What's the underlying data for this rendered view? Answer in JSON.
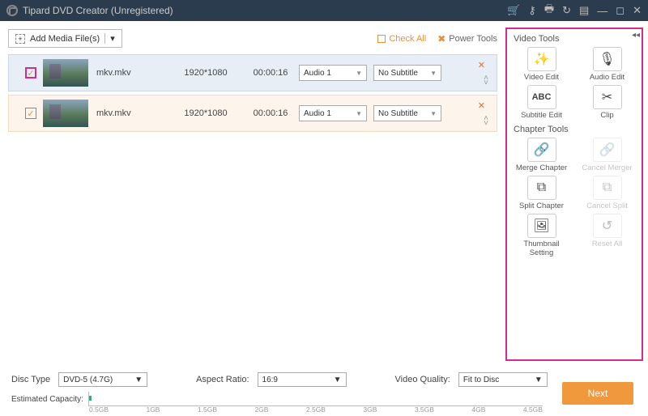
{
  "titlebar": {
    "title": "Tipard DVD Creator (Unregistered)"
  },
  "toolbar": {
    "add_label": "Add Media File(s)",
    "check_all": "Check All",
    "power_tools": "Power Tools"
  },
  "rows": [
    {
      "filename": "mkv.mkv",
      "resolution": "1920*1080",
      "duration": "00:00:16",
      "audio": "Audio 1",
      "subtitle": "No Subtitle"
    },
    {
      "filename": "mkv.mkv",
      "resolution": "1920*1080",
      "duration": "00:00:16",
      "audio": "Audio 1",
      "subtitle": "No Subtitle"
    }
  ],
  "panel": {
    "video_tools": "Video Tools",
    "chapter_tools": "Chapter Tools",
    "tools": {
      "video_edit": "Video Edit",
      "audio_edit": "Audio Edit",
      "subtitle_edit": "Subtitle Edit",
      "clip": "Clip",
      "merge_chapter": "Merge Chapter",
      "cancel_merger": "Cancel Merger",
      "split_chapter": "Split Chapter",
      "cancel_split": "Cancel Split",
      "thumbnail_setting": "Thumbnail\nSetting",
      "reset_all": "Reset All"
    }
  },
  "bottom": {
    "disc_type_label": "Disc Type",
    "disc_type": "DVD-5 (4.7G)",
    "aspect_label": "Aspect Ratio:",
    "aspect": "16:9",
    "quality_label": "Video Quality:",
    "quality": "Fit to Disc",
    "capacity_label": "Estimated Capacity:",
    "ticks": [
      "0.5GB",
      "1GB",
      "1.5GB",
      "2GB",
      "2.5GB",
      "3GB",
      "3.5GB",
      "4GB",
      "4.5GB"
    ],
    "next": "Next"
  }
}
